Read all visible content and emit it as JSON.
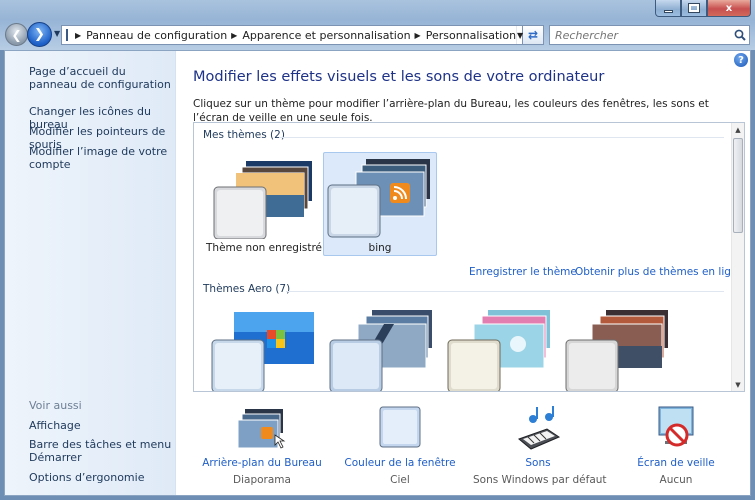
{
  "window": {
    "controls": {
      "minimize": "",
      "maximize": "",
      "close": "x"
    }
  },
  "address": {
    "crumbs": [
      "Panneau de configuration",
      "Apparence et personnalisation",
      "Personnalisation"
    ]
  },
  "search": {
    "placeholder": "Rechercher"
  },
  "sidebar": {
    "items": [
      {
        "label": "Page d’accueil du panneau de configuration"
      },
      {
        "label": "Changer les icônes du bureau"
      },
      {
        "label": "Modifier les pointeurs de souris"
      },
      {
        "label": "Modifier l’image de votre compte"
      }
    ],
    "see_also": {
      "title": "Voir aussi",
      "items": [
        {
          "label": "Affichage"
        },
        {
          "label": "Barre des tâches et menu Démarrer"
        },
        {
          "label": "Options d’ergonomie"
        }
      ]
    }
  },
  "main": {
    "title": "Modifier les effets visuels et les sons de votre ordinateur",
    "description": "Cliquez sur un thème pour modifier l’arrière-plan du Bureau, les couleurs des fenêtres, les sons et l’écran de veille en une seule fois.",
    "my_themes": {
      "header": "Mes thèmes (2)",
      "items": [
        {
          "label": "Thème non enregistré",
          "selected": false
        },
        {
          "label": "bing",
          "selected": true
        }
      ],
      "links": {
        "save": "Enregistrer le thème",
        "more": "Obtenir plus de thèmes en ligne"
      }
    },
    "aero_themes": {
      "header": "Thèmes Aero (7)"
    }
  },
  "bottom": [
    {
      "title": "Arrière-plan du Bureau",
      "subtitle": "Diaporama",
      "icon": "desktop-background-icon"
    },
    {
      "title": "Couleur de la fenêtre",
      "subtitle": "Ciel",
      "icon": "window-color-icon"
    },
    {
      "title": "Sons",
      "subtitle": "Sons Windows par défaut",
      "icon": "sounds-icon"
    },
    {
      "title": "Écran de veille",
      "subtitle": "Aucun",
      "icon": "screensaver-icon"
    }
  ],
  "colors": {
    "link": "#1e5ec7",
    "title": "#1e3287",
    "selection": "#dbe9fa"
  }
}
